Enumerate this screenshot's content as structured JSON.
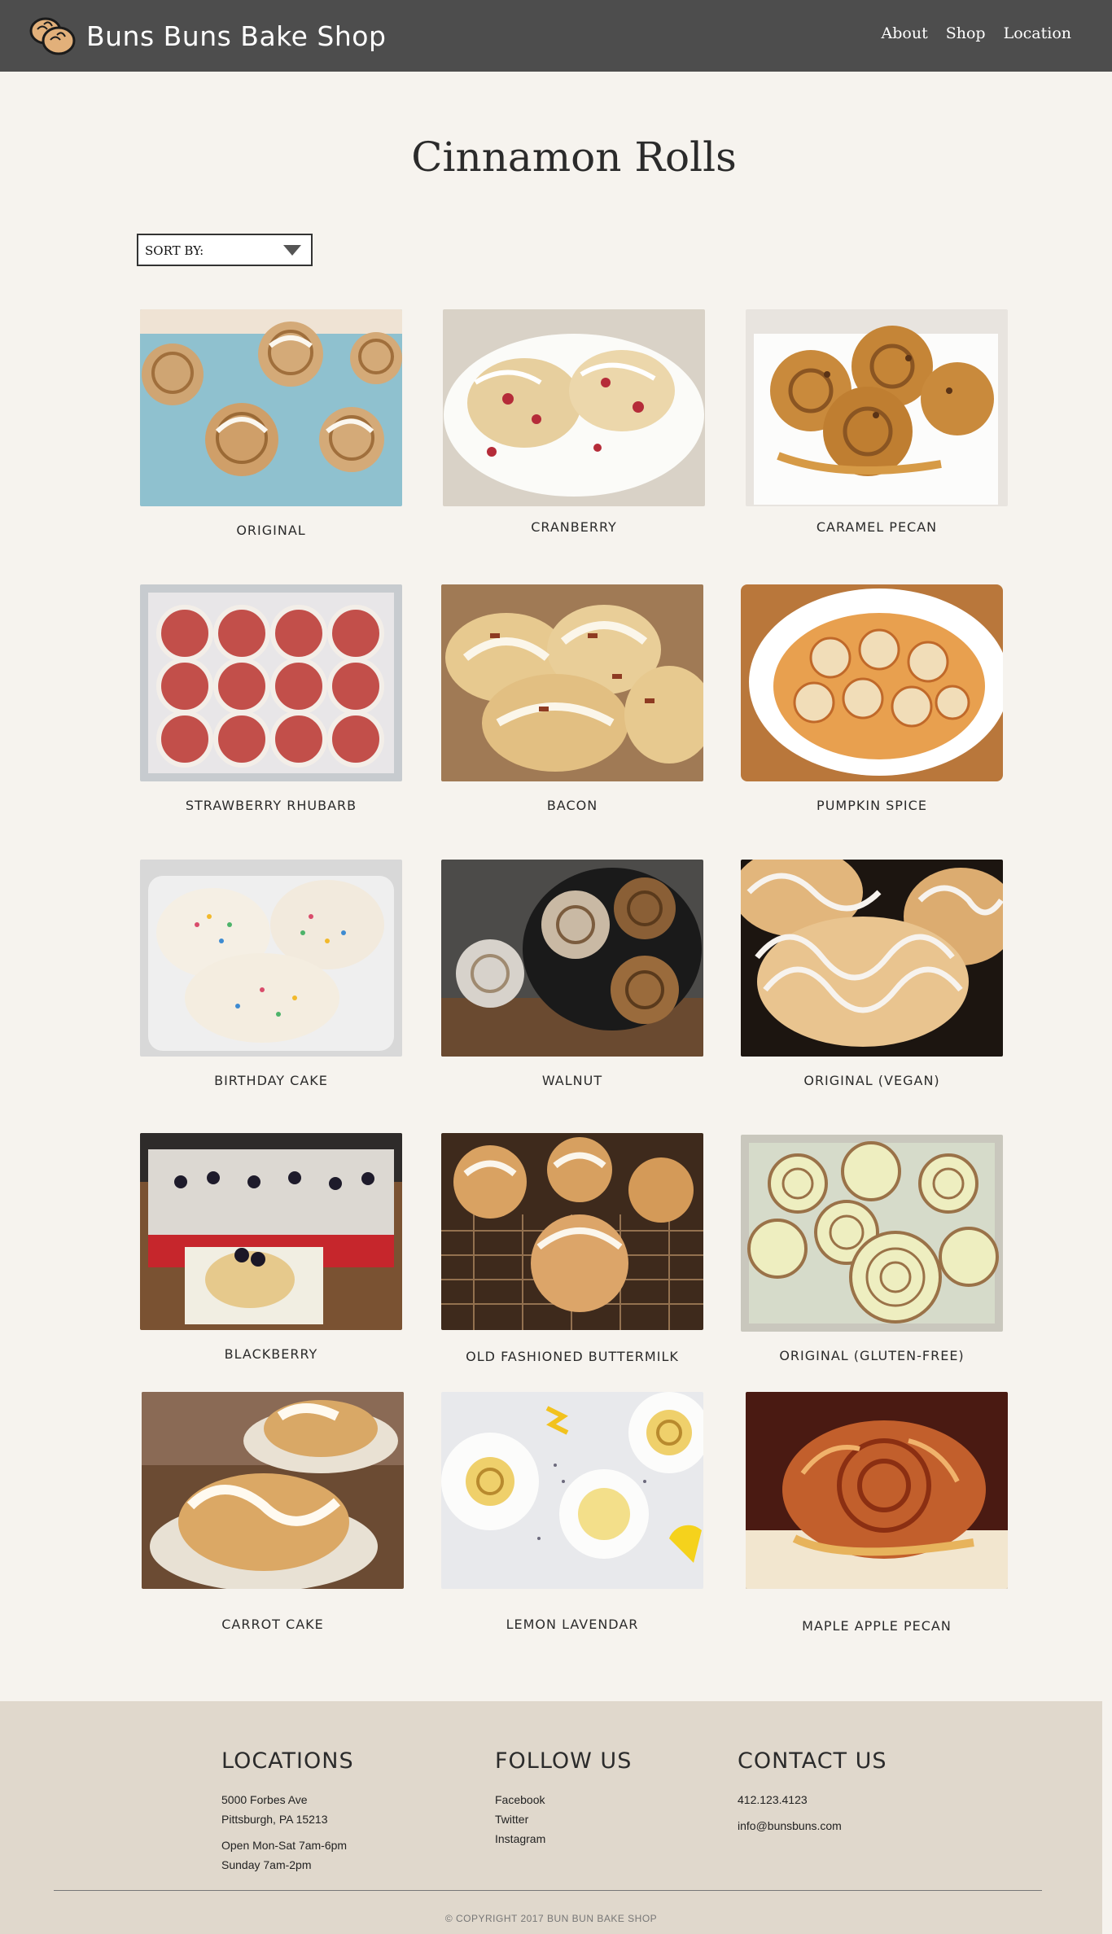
{
  "nav": {
    "brand": "Buns Buns Bake Shop",
    "links": [
      "About",
      "Shop",
      "Location"
    ]
  },
  "page": {
    "title": "Cinnamon Rolls",
    "sort_label": "SORT BY:"
  },
  "products": [
    {
      "name": "ORIGINAL"
    },
    {
      "name": "CRANBERRY"
    },
    {
      "name": "CARAMEL PECAN"
    },
    {
      "name": "STRAWBERRY RHUBARB"
    },
    {
      "name": "BACON"
    },
    {
      "name": "PUMPKIN SPICE"
    },
    {
      "name": "BIRTHDAY CAKE"
    },
    {
      "name": "WALNUT"
    },
    {
      "name": "ORIGINAL (VEGAN)"
    },
    {
      "name": "BLACKBERRY"
    },
    {
      "name": "OLD FASHIONED BUTTERMILK"
    },
    {
      "name": "ORIGINAL (GLUTEN-FREE)"
    },
    {
      "name": "CARROT CAKE"
    },
    {
      "name": "LEMON LAVENDAR"
    },
    {
      "name": "MAPLE APPLE PECAN"
    }
  ],
  "footer": {
    "locations": {
      "heading": "LOCATIONS",
      "address_line1": "5000 Forbes Ave",
      "address_line2": "Pittsburgh, PA 15213",
      "hours_line1": "Open Mon-Sat 7am-6pm",
      "hours_line2": "Sunday 7am-2pm"
    },
    "follow": {
      "heading": "FOLLOW US",
      "links": [
        "Facebook",
        "Twitter",
        "Instagram"
      ]
    },
    "contact": {
      "heading": "CONTACT US",
      "phone": "412.123.4123",
      "email": "info@bunsbuns.com"
    },
    "copyright": "© COPYRIGHT 2017 BUN BUN BAKE SHOP"
  }
}
